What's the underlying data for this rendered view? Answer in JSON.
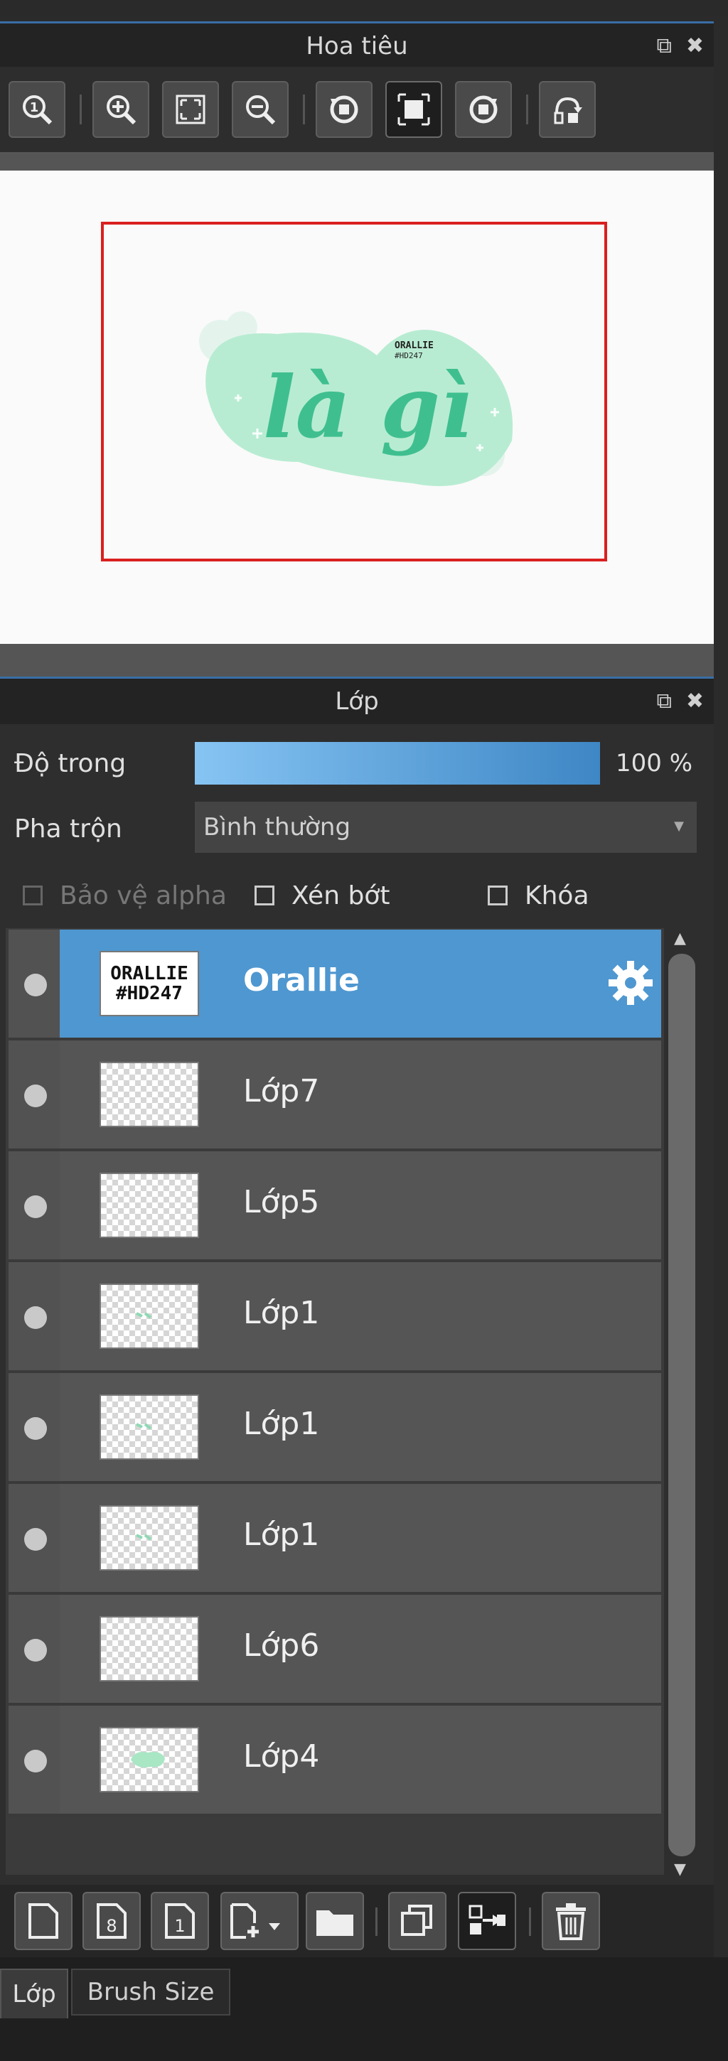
{
  "navigator": {
    "title": "Hoa tiêu",
    "tools": [
      {
        "icon": "zoom-actual-icon"
      },
      {
        "icon": "zoom-in-icon"
      },
      {
        "icon": "fit-window-icon"
      },
      {
        "icon": "zoom-out-icon"
      },
      {
        "icon": "rotate-left-icon"
      },
      {
        "icon": "fit-canvas-icon"
      },
      {
        "icon": "rotate-right-icon"
      },
      {
        "icon": "flip-horizontal-icon"
      }
    ],
    "preview": {
      "main_text": "là gì",
      "small_text_1": "ORALLIE",
      "small_text_2": "#HD247"
    }
  },
  "layers_panel": {
    "title": "Lớp",
    "opacity_label": "Độ trong",
    "opacity_value": "100 %",
    "opacity_fraction": 1.0,
    "blend_label": "Pha trộn",
    "blend_value": "Bình thường",
    "protect_alpha_label": "Bảo vệ alpha",
    "clipping_label": "Xén bớt",
    "lock_label": "Khóa",
    "layers": [
      {
        "name": "Orallie",
        "selected": true,
        "thumb": "text",
        "thumb_text_1": "ORALLIE",
        "thumb_text_2": "#HD247"
      },
      {
        "name": "Lớp7",
        "selected": false,
        "thumb": "empty"
      },
      {
        "name": "Lớp5",
        "selected": false,
        "thumb": "empty"
      },
      {
        "name": "Lớp1",
        "selected": false,
        "thumb": "mark"
      },
      {
        "name": "Lớp1",
        "selected": false,
        "thumb": "mark"
      },
      {
        "name": "Lớp1",
        "selected": false,
        "thumb": "mark"
      },
      {
        "name": "Lớp6",
        "selected": false,
        "thumb": "empty"
      },
      {
        "name": "Lớp4",
        "selected": false,
        "thumb": "blob"
      }
    ],
    "bottom_tools": [
      {
        "icon": "new-layer-icon"
      },
      {
        "icon": "new-8bit-layer-icon",
        "glyph": "8"
      },
      {
        "icon": "new-1bit-layer-icon",
        "glyph": "1"
      },
      {
        "icon": "add-layer-dropdown-icon"
      },
      {
        "icon": "folder-icon"
      },
      {
        "icon": "duplicate-layer-icon"
      },
      {
        "icon": "merge-down-icon"
      },
      {
        "icon": "delete-layer-icon"
      }
    ]
  },
  "bottom_tabs": [
    {
      "label": "Lớp",
      "active": true
    },
    {
      "label": "Brush Size",
      "active": false
    }
  ],
  "colors": {
    "accent": "#4f97d0",
    "preview_frame": "#d9201f",
    "mint": "#a8e6c4",
    "lettering": "#3fbf8f"
  }
}
